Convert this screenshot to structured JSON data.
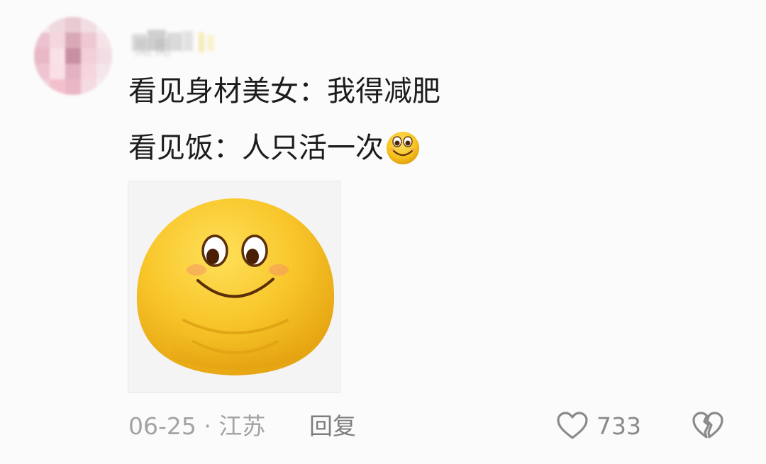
{
  "comment": {
    "text_line1": "看见身材美女：我得减肥",
    "text_line2": "看见饭：人只活一次",
    "inline_emoji": "smile-emoji",
    "sticker_icon": "chubby-smile-sticker",
    "date": "06-25",
    "separator": "·",
    "location": "江苏",
    "reply_label": "回复",
    "like_icon": "heart-icon",
    "like_count": "733",
    "dislike_icon": "broken-heart-icon"
  },
  "colors": {
    "emoji_yellow": "#f6c21c",
    "emoji_shadow": "#e0a010",
    "meta_gray": "#a3a3a3",
    "text_dark": "#1c1c1c"
  }
}
